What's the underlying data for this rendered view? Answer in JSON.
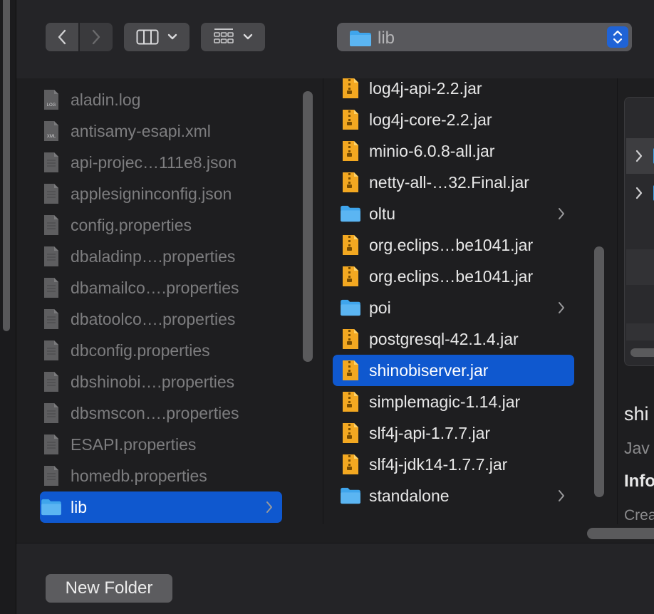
{
  "toolbar": {
    "path_label": "lib"
  },
  "column1": {
    "items": [
      {
        "name": "aladin.log",
        "icon": "log-file-icon",
        "badge": "LOG"
      },
      {
        "name": "antisamy-esapi.xml",
        "icon": "xml-file-icon",
        "badge": "XML"
      },
      {
        "name": "api-projec…111e8.json",
        "icon": "json-file-icon",
        "badge": ""
      },
      {
        "name": "applesigninconfig.json",
        "icon": "json-file-icon",
        "badge": ""
      },
      {
        "name": "config.properties",
        "icon": "text-file-icon",
        "badge": ""
      },
      {
        "name": "dbaladinp….properties",
        "icon": "text-file-icon",
        "badge": ""
      },
      {
        "name": "dbamailco….properties",
        "icon": "text-file-icon",
        "badge": ""
      },
      {
        "name": "dbatoolco….properties",
        "icon": "text-file-icon",
        "badge": ""
      },
      {
        "name": "dbconfig.properties",
        "icon": "text-file-icon",
        "badge": ""
      },
      {
        "name": "dbshinobi….properties",
        "icon": "text-file-icon",
        "badge": ""
      },
      {
        "name": "dbsmscon….properties",
        "icon": "text-file-icon",
        "badge": ""
      },
      {
        "name": "ESAPI.properties",
        "icon": "text-file-icon",
        "badge": ""
      },
      {
        "name": "homedb.properties",
        "icon": "text-file-icon",
        "badge": ""
      },
      {
        "name": "lib",
        "icon": "folder-icon",
        "badge": "",
        "selected": true
      }
    ]
  },
  "column2": {
    "items": [
      {
        "name": "log4j-api-2.2.jar",
        "type": "jar"
      },
      {
        "name": "log4j-core-2.2.jar",
        "type": "jar"
      },
      {
        "name": "minio-6.0.8-all.jar",
        "type": "jar"
      },
      {
        "name": "netty-all-…32.Final.jar",
        "type": "jar"
      },
      {
        "name": "oltu",
        "type": "folder"
      },
      {
        "name": "org.eclips…be1041.jar",
        "type": "jar"
      },
      {
        "name": "org.eclips…be1041.jar",
        "type": "jar"
      },
      {
        "name": "poi",
        "type": "folder"
      },
      {
        "name": "postgresql-42.1.4.jar",
        "type": "jar"
      },
      {
        "name": "shinobiserver.jar",
        "type": "jar",
        "selected": true
      },
      {
        "name": "simplemagic-1.14.jar",
        "type": "jar"
      },
      {
        "name": "slf4j-api-1.7.7.jar",
        "type": "jar"
      },
      {
        "name": "slf4j-jdk14-1.7.7.jar",
        "type": "jar"
      },
      {
        "name": "standalone",
        "type": "folder"
      }
    ]
  },
  "preview": {
    "title": "shi",
    "kind": "Jav",
    "info_heading": "Info",
    "created_label": "Crea"
  },
  "bottom": {
    "new_folder_label": "New Folder"
  },
  "colors": {
    "selection": "#0f58cf",
    "folder": "#3fa5ec",
    "jar": "#f3a821"
  }
}
